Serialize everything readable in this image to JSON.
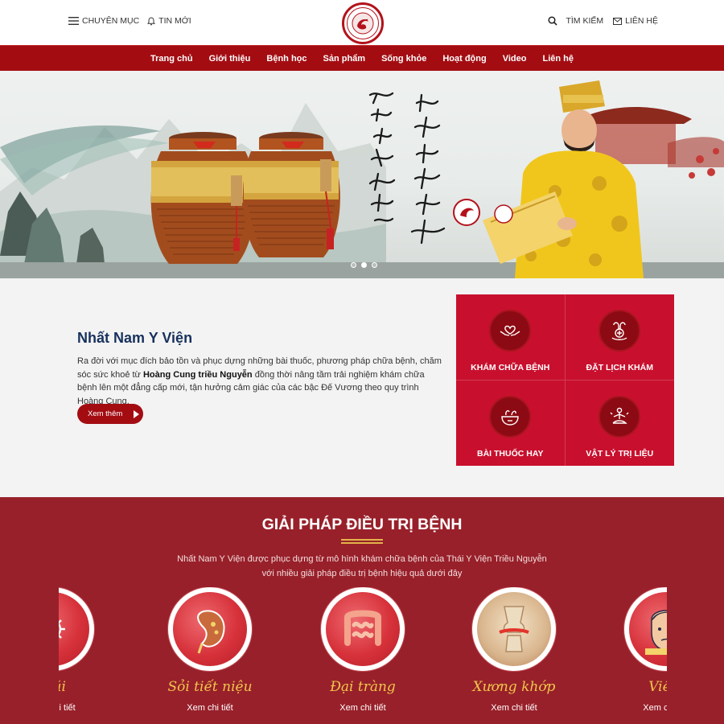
{
  "header": {
    "menu_label": "CHUYÊN MỤC",
    "news_label": "TIN MỚI",
    "search_label": "TÌM KIẾM",
    "contact_label": "LIÊN HỆ"
  },
  "nav": {
    "items": [
      "Trang chủ",
      "Giới thiệu",
      "Bệnh học",
      "Sản phẩm",
      "Sống khỏe",
      "Hoạt động",
      "Video",
      "Liên hệ"
    ]
  },
  "intro": {
    "title": "Nhất Nam Y Viện",
    "text_before": "Ra đời với mục đích bảo tồn và phục dựng những bài thuốc, phương pháp chữa bệnh, chăm sóc sức khoẻ từ ",
    "text_bold": "Hoàng Cung triều Nguyễn",
    "text_after": " đồng thời nâng tầm trải nghiệm khám chữa bệnh lên một đẳng cấp mới, tận hưởng cảm giác của các bậc Đế Vương theo quy trình Hoàng Cung.",
    "button_label": "Xem thêm"
  },
  "services": [
    {
      "label": "KHÁM CHỮA BỆNH",
      "icon": "heart-hands-icon"
    },
    {
      "label": "ĐẶT LỊCH KHÁM",
      "icon": "medical-calendar-icon"
    },
    {
      "label": "BÀI THUỐC HAY",
      "icon": "herbal-bowl-icon"
    },
    {
      "label": "VẬT LÝ TRỊ LIỆU",
      "icon": "meditation-icon"
    }
  ],
  "solutions": {
    "title": "GIẢI PHÁP ĐIỀU TRỊ BỆNH",
    "desc_line1": "Nhất Nam Y Viện được phục dựng từ mô hình khám chữa bệnh của Thái Y Viện Triều Nguyễn",
    "desc_line2": "với nhiều giải pháp điều trị bệnh hiệu quả dưới đây",
    "cards": [
      {
        "name": "Mũi",
        "link": "Xem chi tiết",
        "icon": "virus-icon"
      },
      {
        "name": "Sỏi tiết niệu",
        "link": "Xem chi tiết",
        "icon": "kidney-icon"
      },
      {
        "name": "Đại tràng",
        "link": "Xem chi tiết",
        "icon": "intestine-icon"
      },
      {
        "name": "Xương khớp",
        "link": "Xem chi tiết",
        "icon": "knee-joint-icon"
      },
      {
        "name": "Viêm",
        "link": "Xem chi tiết",
        "icon": "face-icon"
      }
    ]
  },
  "hero": {
    "slides_count": 3,
    "active_slide": 1
  },
  "colors": {
    "brand_red": "#a30d12",
    "service_red": "#c8102e",
    "section_red": "#98202a",
    "gold": "#f0c64b",
    "title_blue": "#17315e"
  }
}
